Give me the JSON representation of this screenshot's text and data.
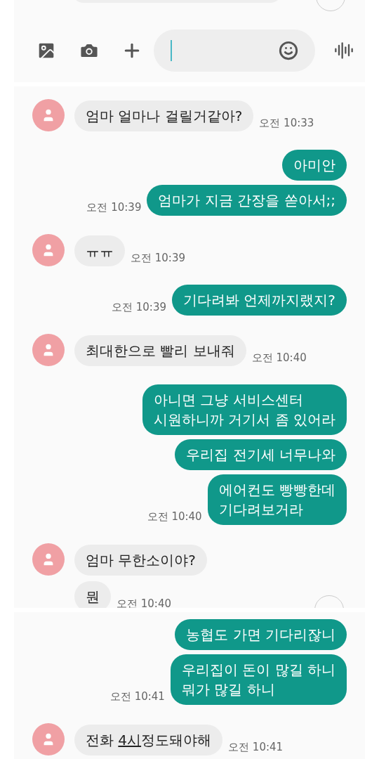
{
  "panels": [
    {
      "kind": "composer"
    },
    {
      "kind": "chat",
      "scroll_button": true,
      "messages": [
        {
          "kind": "received",
          "avatar": true,
          "parts": [
            {
              "text": "엄마 얼마나 걸릴거같아?"
            }
          ],
          "time": "오전 10:33"
        },
        {
          "kind": "sent",
          "parts": [
            {
              "text": "아미안"
            }
          ]
        },
        {
          "kind": "sent",
          "parts": [
            {
              "text": "엄마가 지금 간장을 쏟아서;;"
            }
          ],
          "time": "오전 10:39"
        },
        {
          "kind": "received",
          "avatar": true,
          "parts": [
            {
              "text": "ㅠㅠ"
            }
          ],
          "time": "오전 10:39"
        },
        {
          "kind": "sent",
          "parts": [
            {
              "text": "기다려봐 언제까지랬지?"
            }
          ],
          "time": "오전 10:39"
        },
        {
          "kind": "received",
          "avatar": true,
          "parts": [
            {
              "text": "최대한으로 빨리 보내줘"
            }
          ],
          "time": "오전 10:40"
        },
        {
          "kind": "sent",
          "parts": [
            {
              "text": "아니면 그냥 서비스센터\n시원하니까 거기서 좀 있어라"
            }
          ]
        },
        {
          "kind": "sent",
          "parts": [
            {
              "text": "우리집 전기세 너무나와"
            }
          ]
        },
        {
          "kind": "sent",
          "parts": [
            {
              "text": "에어컨도 빵빵한데\n기다려보거라"
            }
          ],
          "time": "오전 10:40"
        },
        {
          "kind": "received",
          "avatar": true,
          "parts": [
            {
              "text": "엄마 무한소이야?"
            }
          ]
        },
        {
          "kind": "received",
          "avatar": false,
          "parts": [
            {
              "text": "뭔"
            }
          ],
          "time": "오전 10:40"
        }
      ]
    },
    {
      "kind": "chat",
      "messages": [
        {
          "kind": "sent",
          "parts": [
            {
              "text": "농협도 가면 기다리잖니"
            }
          ]
        },
        {
          "kind": "sent",
          "parts": [
            {
              "text": "우리집이 돈이 많길 하니\n뭐가 많길 하니"
            }
          ],
          "time": "오전 10:41"
        },
        {
          "kind": "received",
          "avatar": true,
          "parts": [
            {
              "text": "전화 "
            },
            {
              "text": "4시",
              "underline": true
            },
            {
              "text": "정도돼야해"
            }
          ],
          "time": "오전 10:41"
        }
      ]
    }
  ]
}
